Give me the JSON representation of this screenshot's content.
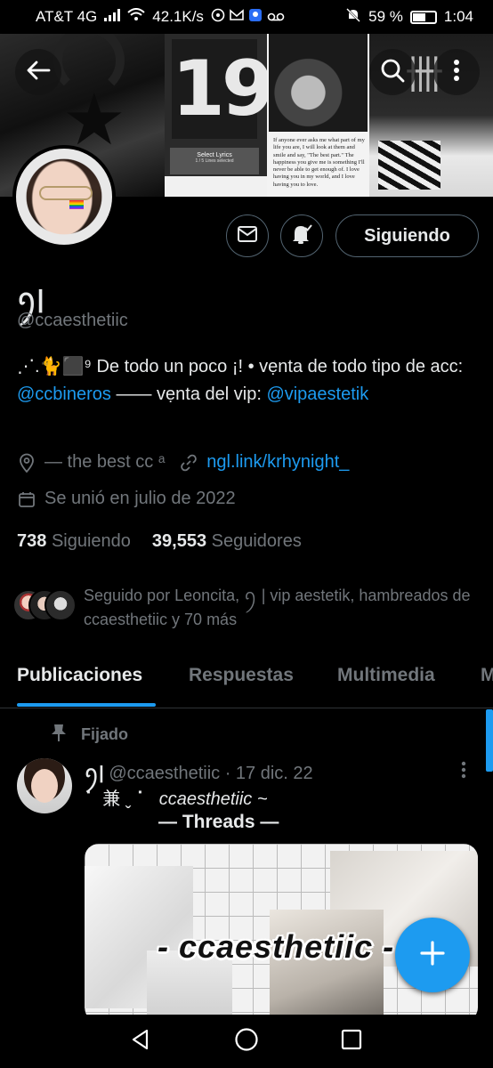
{
  "status_bar": {
    "carrier": "AT&T 4G",
    "speed": "42.1K/s",
    "battery": "59 %",
    "battery_level": 0.59,
    "time": "1:04"
  },
  "banner": {
    "number": "19",
    "lyrics_title": "Select Lyrics",
    "lyrics_sub": "1 / 5 Lines selected",
    "quote": "If anyone ever asks me what part of my life you are, I will look at them and smile and say, \"The best part.\" The happiness you give me is something I'll never be able to get enough of. I love having you in my world, and I love having you to love."
  },
  "profile": {
    "display_name": "ꪆ|",
    "handle": "@ccaesthetiic",
    "bio_prefix": "⋰.🐈⬛⁹ De todo un poco ¡! • vẹnta de todo tipo de acc: ",
    "bio_link1": "@ccbineros",
    "bio_middle": " —— vẹnta del vip: ",
    "bio_link2": "@vipaestetik",
    "location": "— the best cc ᵃ",
    "website": "ngl.link/krhynight_",
    "joined": "Se unió en julio de 2022",
    "following_count": "738",
    "following_label": "Siguiendo",
    "followers_count": "39,553",
    "followers_label": "Seguidores",
    "followed_by": "Seguido por Leoncita, ꪆ | vip aestetik, hambreados de ccaesthetiic y 70 más"
  },
  "buttons": {
    "follow_label": "Siguiendo"
  },
  "tabs": [
    {
      "label": "Publicaciones"
    },
    {
      "label": "Respuestas"
    },
    {
      "label": "Multimedia"
    },
    {
      "label": "M"
    }
  ],
  "post": {
    "pinned_label": "Fijado",
    "author_name": "ꪆ|",
    "author_handle": "@ccaesthetiic",
    "date": "· 17 dic. 22",
    "line1_prefix": "⠁ 兼 ˬ ⠁",
    "line1_italic": "ccaesthetiic ~",
    "line2": "— Threads —",
    "image_text": "- ccaesthetiic -"
  },
  "colors": {
    "accent": "#1d9bf0",
    "background": "#000000",
    "muted_text": "#71767b",
    "primary_text": "#e7e9ea"
  }
}
